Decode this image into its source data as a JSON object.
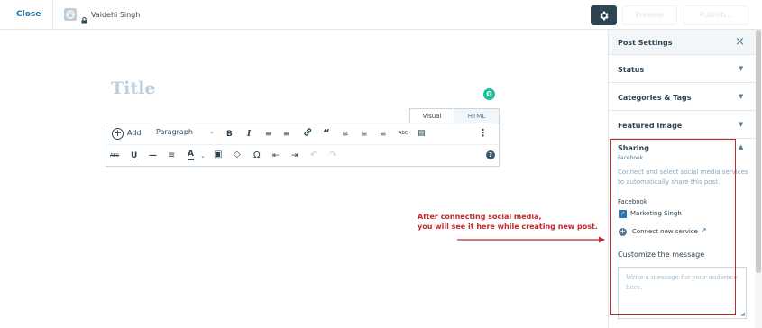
{
  "topbar": {
    "close_label": "Close",
    "site_name": "Vaidehi Singh",
    "preview_label": "Preview",
    "publish_label": "Publish..."
  },
  "editor": {
    "title_placeholder": "Title",
    "grammarly_letter": "G",
    "tabs": [
      "Visual",
      "HTML"
    ],
    "add_label": "Add",
    "paragraph_select": "Paragraph",
    "toolbar_row1": [
      "B",
      "I",
      "☰",
      "≡",
      "🔗",
      "“",
      "≡",
      "≡",
      "≡",
      "ABC",
      "▬",
      "⋮"
    ],
    "toolbar_row2": [
      "ABC",
      "U",
      "—",
      "≡",
      "A",
      "▾",
      "▣",
      "◇",
      "Ω",
      "⇤",
      "⇥",
      "↶",
      "↷"
    ],
    "help": "?"
  },
  "sidebar": {
    "header_title": "Post Settings",
    "close_glyph": "×",
    "sections": [
      "Status",
      "Categories & Tags",
      "Featured Image"
    ],
    "sharing": {
      "title": "Sharing",
      "subtitle": "Facebook",
      "description": "Connect and select social media services to automatically share this post.",
      "network_label": "Facebook",
      "account_name": "Marketing Singh",
      "connect_label": "Connect new service",
      "customize_label": "Customize the message",
      "message_placeholder": "Write a message for your audience here."
    }
  },
  "annotation": {
    "line1": "After connecting social media,",
    "line2": "you will see it here while creating new post."
  },
  "colors": {
    "accent": "#2578b5",
    "dark": "#2e4453",
    "highlight": "#c0282e",
    "grammarly": "#15c39a"
  }
}
